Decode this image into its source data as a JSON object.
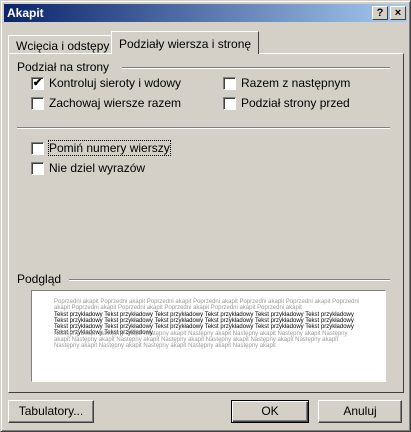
{
  "window": {
    "title": "Akapit",
    "help_glyph": "?",
    "close_glyph": "×"
  },
  "tabs": [
    {
      "label": "Wcięcia i odstępy",
      "active": false
    },
    {
      "label": "Podziały wiersza i stronę",
      "active": true
    }
  ],
  "pagination": {
    "group_label": "Podział na strony",
    "options": [
      {
        "label": "Kontroluj sieroty i wdowy",
        "checked": true
      },
      {
        "label": "Razem z następnym",
        "checked": false
      },
      {
        "label": "Zachowaj wiersze razem",
        "checked": false
      },
      {
        "label": "Podział strony przed",
        "checked": false
      }
    ]
  },
  "other": {
    "options": [
      {
        "label": "Pomiń numery wierszy",
        "checked": false
      },
      {
        "label": "Nie dziel wyrazów",
        "checked": false
      }
    ]
  },
  "preview": {
    "label": "Podgląd",
    "prev_text": "Poprzedni akapit Poprzedni akapit Poprzedni akapit Poprzedni akapit Poprzedni akapit Poprzedni akapit Poprzedni akapit Poprzedni akapit Poprzedni akapit Poprzedni akapit Poprzedni akapit Poprzedni akapit",
    "sample_text": "Tekst przykładowy Tekst przykładowy Tekst przykładowy Tekst przykładowy Tekst przykładowy Tekst przykładowy Tekst przykładowy Tekst przykładowy Tekst przykładowy Tekst przykładowy Tekst przykładowy Tekst przykładowy Tekst przykładowy Tekst przykładowy Tekst przykładowy Tekst przykładowy Tekst przykładowy Tekst przykładowy Tekst przykładowy Tekst przykładowy",
    "next_text": "Następny akapit Następny akapit Następny akapit Następny akapit Następny akapit Następny akapit Następny akapit Następny akapit Następny akapit Następny akapit Następny akapit Następny akapit Następny akapit Następny akapit Następny akapit Następny akapit Następny akapit Następny akapit"
  },
  "buttons": {
    "tabs": "Tabulatory...",
    "ok": "OK",
    "cancel": "Anuluj"
  },
  "colors": {
    "titlebar_start": "#0a246a",
    "titlebar_end": "#a6caf0",
    "face": "#d4d0c8"
  }
}
